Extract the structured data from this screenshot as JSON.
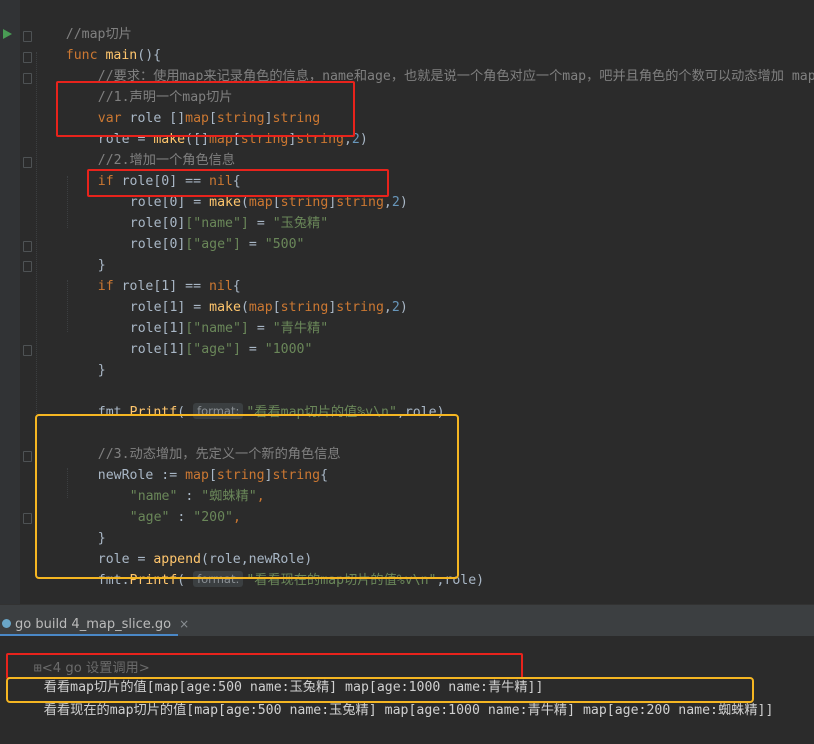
{
  "code": {
    "comment_header": "//map切片",
    "func_kw": "func",
    "main_name": "main",
    "main_open": "(){",
    "comment_requirement": "//要求：使用map来记录角色的信息，name和age，也就是说一个角色对应一个map，吧并且角色的个数可以动态增加 map切片",
    "comment_step1": "//1.声明一个map切片",
    "var_kw": "var",
    "role_ident": "role",
    "slice_brackets": " []",
    "map_kw": "map",
    "lbr": "[",
    "string_kw": "string",
    "rbr": "]",
    "assign": " = ",
    "make_fn": "make",
    "make_open_slice": "([]",
    "comma": ",",
    "num_2": "2",
    "rparen": ")",
    "comment_step2": "//2.增加一个角色信息",
    "if_kw": "if",
    "role0": "role[0]",
    "role1": "role[1]",
    "eq_op": " == ",
    "nil_kw": "nil",
    "brace_open": "{",
    "brace_close": "}",
    "make_open": "(",
    "idx_name": "[\"name\"]",
    "idx_age": "[\"age\"]",
    "val_yutu": "\"玉兔精\"",
    "val_500": "\"500\"",
    "val_qingniu": "\"青牛精\"",
    "val_1000": "\"1000\"",
    "fmt_pkg": "fmt.",
    "printf_fn": "Printf",
    "hint_format": "format:",
    "printf_str1": "\"看看map切片的值%v\\n\"",
    "printf_args": ",role)",
    "comment_step3": "//3.动态增加，先定义一个新的角色信息",
    "newrole_ident": "newRole",
    "decl_assign": " := ",
    "key_name": "\"name\"",
    "key_age": "\"age\"",
    "kv_sep": " : ",
    "val_zhizhu": "\"蜘蛛精\"",
    "val_200": "\"200\"",
    "trail_comma": ",",
    "append_fn": "append",
    "append_args": "(role,newRole)",
    "printf_str2": "\"看看现在的map切片的值%v\\n\"",
    "printf_args2": ",role)"
  },
  "run_panel": {
    "tab_label": "go build 4_map_slice.go",
    "close_glyph": "×",
    "fold_glyph": "⊞",
    "command_line": "<4 go 设置调用>",
    "output_line1": "看看map切片的值[map[age:500 name:玉兔精] map[age:1000 name:青牛精]]",
    "output_line2": "看看现在的map切片的值[map[age:500 name:玉兔精] map[age:1000 name:青牛精] map[age:200 name:蜘蛛精]]"
  },
  "annotation_colors": {
    "red": "#e8231c",
    "orange": "#f5b622"
  },
  "icons": [
    "run-gutter-icon",
    "fold-marker-icon",
    "go-file-icon",
    "close-icon"
  ]
}
